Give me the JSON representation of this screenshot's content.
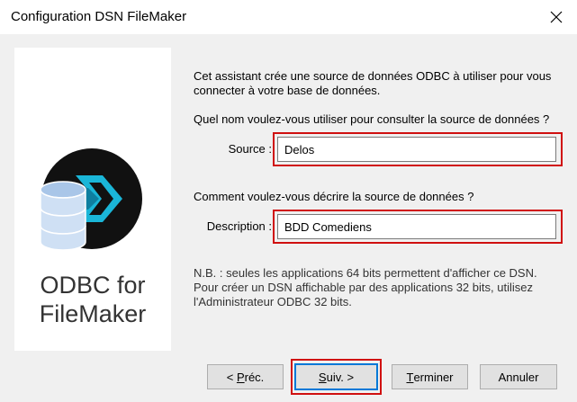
{
  "window": {
    "title": "Configuration DSN FileMaker"
  },
  "logo": {
    "line1": "ODBC for",
    "line2": "FileMaker"
  },
  "intro": "Cet assistant crée une source de données ODBC à utiliser pour vous connecter à votre base de données.",
  "question_source": "Quel nom voulez-vous utiliser pour consulter la source de données ?",
  "source": {
    "label": "Source :",
    "value": "Delos"
  },
  "question_description": "Comment voulez-vous décrire la source de données ?",
  "description": {
    "label": "Description :",
    "value": "BDD Comediens"
  },
  "note": {
    "line1": "N.B. : seules les applications 64 bits permettent d'afficher ce DSN.",
    "line2": "Pour créer un DSN affichable par des applications 32 bits, utilisez",
    "line3": "l'Administrateur ODBC 32 bits."
  },
  "buttons": {
    "prev": {
      "mnemonic_pre": "< ",
      "mnemonic": "P",
      "rest": "réc."
    },
    "next": {
      "mnemonic": "S",
      "rest": "uiv. >"
    },
    "finish": {
      "mnemonic": "T",
      "rest": "erminer"
    },
    "cancel": "Annuler"
  },
  "colors": {
    "highlight_border": "#d01010",
    "focus_border": "#0078d7"
  }
}
